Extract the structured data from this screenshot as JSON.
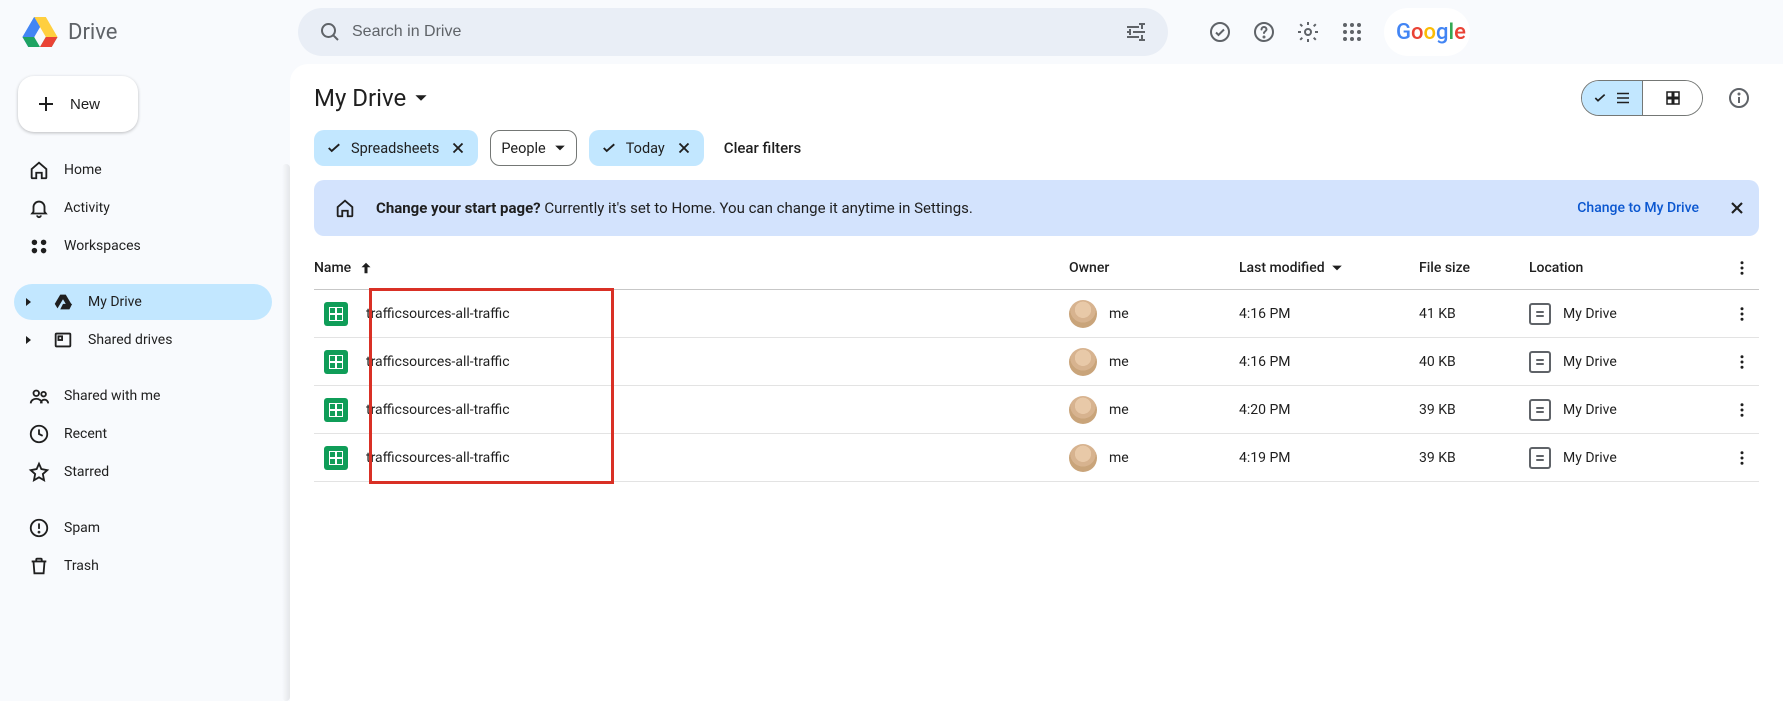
{
  "app": {
    "name": "Drive"
  },
  "search": {
    "placeholder": "Search in Drive"
  },
  "new_button": "New",
  "nav": {
    "home": "Home",
    "activity": "Activity",
    "workspaces": "Workspaces",
    "my_drive": "My Drive",
    "shared_drives": "Shared drives",
    "shared_with_me": "Shared with me",
    "recent": "Recent",
    "starred": "Starred",
    "spam": "Spam",
    "trash": "Trash"
  },
  "page": {
    "title": "My Drive"
  },
  "chips": {
    "spreadsheets": "Spreadsheets",
    "people": "People",
    "today": "Today",
    "clear": "Clear filters"
  },
  "banner": {
    "lead": "Change your start page?",
    "rest": " Currently it's set to Home. You can change it anytime in Settings.",
    "action": "Change to My Drive"
  },
  "columns": {
    "name": "Name",
    "owner": "Owner",
    "last_modified": "Last modified",
    "file_size": "File size",
    "location": "Location"
  },
  "owner_label": "me",
  "location_label": "My Drive",
  "rows": [
    {
      "name": "trafficsources-all-traffic",
      "modified": "4:16 PM",
      "size": "41 KB"
    },
    {
      "name": "trafficsources-all-traffic",
      "modified": "4:16 PM",
      "size": "40 KB"
    },
    {
      "name": "trafficsources-all-traffic",
      "modified": "4:20 PM",
      "size": "39 KB"
    },
    {
      "name": "trafficsources-all-traffic",
      "modified": "4:19 PM",
      "size": "39 KB"
    }
  ],
  "google_letters": [
    {
      "c": "#4285F4",
      "t": "G"
    },
    {
      "c": "#EA4335",
      "t": "o"
    },
    {
      "c": "#FBBC05",
      "t": "o"
    },
    {
      "c": "#4285F4",
      "t": "g"
    },
    {
      "c": "#34A853",
      "t": "l"
    },
    {
      "c": "#EA4335",
      "t": "e"
    }
  ]
}
